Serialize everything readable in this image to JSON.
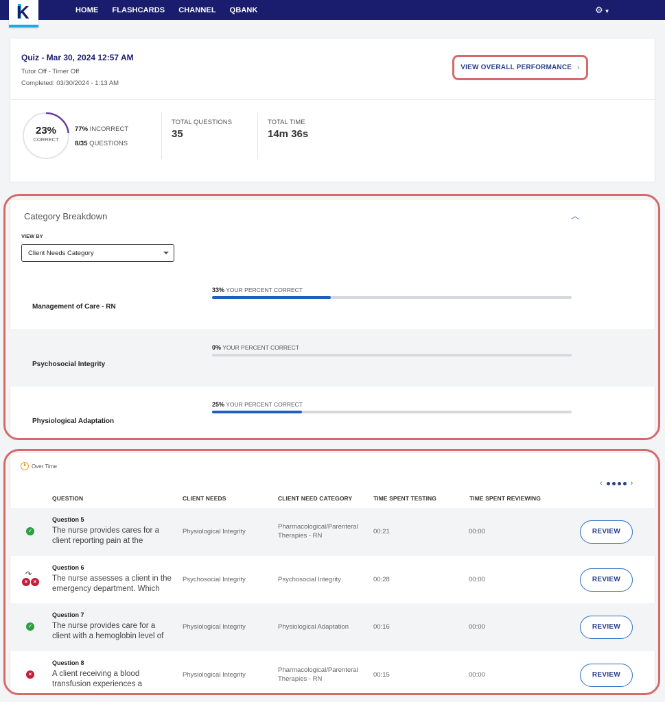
{
  "nav": {
    "logo_letter": "K",
    "links": [
      "HOME",
      "FLASHCARDS",
      "CHANNEL",
      "QBANK"
    ],
    "settings_icon": "gear-icon"
  },
  "quiz": {
    "title": "Quiz - Mar 30, 2024 12:57 AM",
    "mode": "Tutor Off - Timer Off",
    "completed": "Completed: 03/30/2024 - 1:13 AM",
    "view_performance": "VIEW OVERALL PERFORMANCE",
    "percent_correct": "23%",
    "percent_correct_value": 0.23,
    "correct_label": "CORRECT",
    "incorrect_pct": "77%",
    "incorrect_label": "INCORRECT",
    "questions_ratio": "8/35",
    "questions_label": "QUESTIONS",
    "total_questions_label": "TOTAL QUESTIONS",
    "total_questions": "35",
    "total_time_label": "TOTAL TIME",
    "total_time": "14m 36s"
  },
  "category": {
    "title": "Category Breakdown",
    "view_by_label": "VIEW BY",
    "view_by_value": "Client Needs Category",
    "pct_suffix": "YOUR PERCENT CORRECT",
    "rows": [
      {
        "name": "Management of Care - RN",
        "pct": "33%",
        "value": 0.33
      },
      {
        "name": "Psychosocial Integrity",
        "pct": "0%",
        "value": 0.0
      },
      {
        "name": "Physiological Adaptation",
        "pct": "25%",
        "value": 0.25
      }
    ]
  },
  "questions": {
    "over_time_label": "Over Time",
    "headers": {
      "question": "QUESTION",
      "client_needs": "CLIENT NEEDS",
      "client_need_category": "CLIENT NEED CATEGORY",
      "time_testing": "TIME SPENT TESTING",
      "time_reviewing": "TIME SPENT REVIEWING"
    },
    "review_label": "REVIEW",
    "rows": [
      {
        "status": "correct",
        "number": "Question 5",
        "text": "The nurse provides cares for a client reporting pain at the",
        "client_needs": "Physiological Integrity",
        "category": "Pharmacological/Parenteral Therapies - RN",
        "testing": "00:21",
        "reviewing": "00:00"
      },
      {
        "status": "changed-incorrect",
        "number": "Question 6",
        "text": "The nurse assesses a client in the emergency department. Which",
        "client_needs": "Psychosocial Integrity",
        "category": "Psychosocial Integrity",
        "testing": "00:28",
        "reviewing": "00:00"
      },
      {
        "status": "correct",
        "number": "Question 7",
        "text": "The nurse provides care for a client with a hemoglobin level of",
        "client_needs": "Physiological Integrity",
        "category": "Physiological Adaptation",
        "testing": "00:16",
        "reviewing": "00:00"
      },
      {
        "status": "incorrect",
        "number": "Question 8",
        "text": "A client receiving a blood transfusion experiences a",
        "client_needs": "Physiological Integrity",
        "category": "Pharmacological/Parenteral Therapies - RN",
        "testing": "00:15",
        "reviewing": "00:00"
      }
    ]
  },
  "colors": {
    "nav_bg": "#1a1d6e",
    "accent_blue": "#1f5fc0",
    "correct_green": "#2e9e3f",
    "incorrect_red": "#c41e3a",
    "highlight": "#d46a6a",
    "donut_arc": "#6b3fa0"
  }
}
